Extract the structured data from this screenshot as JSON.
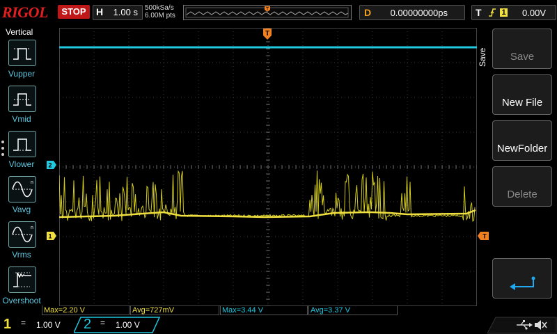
{
  "header": {
    "brand": "RIGOL",
    "run_status": "STOP",
    "timebase_key": "H",
    "timebase": "1.00 s",
    "sample_rate": "500kSa/s",
    "memory_depth": "6.00M pts",
    "delay_key": "D",
    "delay": "0.00000000ps",
    "trigger_key": "T",
    "trigger_source": "1",
    "trigger_level": "0.00V"
  },
  "left_panel": {
    "title": "Vertical",
    "items": [
      {
        "label": "Vupper",
        "icon": "vupper-icon"
      },
      {
        "label": "Vmid",
        "icon": "vmid-icon"
      },
      {
        "label": "Vlower",
        "icon": "vlower-icon"
      },
      {
        "label": "Vavg",
        "icon": "vavg-icon"
      },
      {
        "label": "Vrms",
        "icon": "vrms-icon"
      },
      {
        "label": "Overshoot",
        "icon": "overshoot-icon"
      }
    ]
  },
  "right_menu": {
    "title": "Save",
    "items": [
      {
        "label": "Save",
        "enabled": false
      },
      {
        "label": "New File",
        "enabled": true
      },
      {
        "label": "NewFolder",
        "enabled": true
      },
      {
        "label": "Delete",
        "enabled": false
      }
    ],
    "back_icon": "return-arrow-icon"
  },
  "markers": {
    "trigger_position": "T",
    "ch1_marker": "1",
    "ch2_marker": "2",
    "trigger_level_marker": "T"
  },
  "measurements": [
    {
      "label": "Max=2.20 V",
      "channel": 1
    },
    {
      "label": "Avg=727mV",
      "channel": 1
    },
    {
      "label": "Max=3.44 V",
      "channel": 2
    },
    {
      "label": "Avg=3.37 V",
      "channel": 2
    }
  ],
  "channels": [
    {
      "number": "1",
      "coupling_symbol": "=",
      "scale": "1.00 V",
      "color": "#f0e040"
    },
    {
      "number": "2",
      "coupling_symbol": "=",
      "scale": "1.00 V",
      "color": "#20c8e0"
    }
  ],
  "status_icons": [
    "usb-icon",
    "speaker-mute-icon"
  ],
  "colors": {
    "ch1": "#f0e040",
    "ch2": "#20c8e0",
    "stop": "#c01818",
    "trigger": "#f08020"
  }
}
